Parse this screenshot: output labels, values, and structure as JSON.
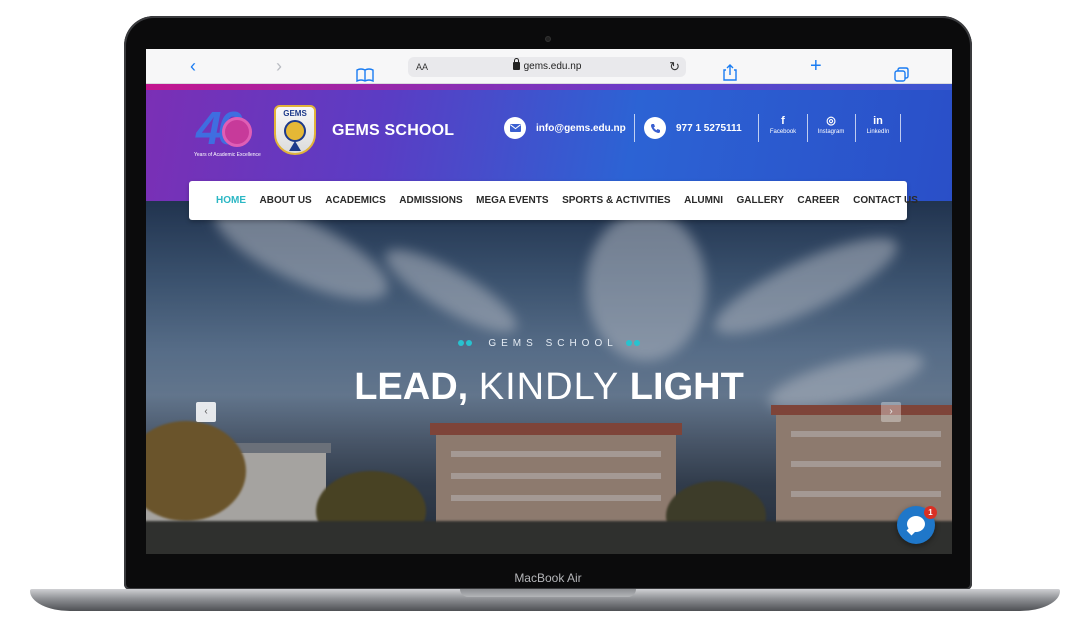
{
  "device": {
    "label": "MacBook Air"
  },
  "browser": {
    "text_size_label": "AA",
    "url": "gems.edu.np",
    "back_glyph": "‹",
    "forward_glyph": "›",
    "bookmarks_icon": "book-icon",
    "share_icon": "share-icon",
    "new_tab_glyph": "+",
    "tabs_icon": "tabs-icon",
    "reload_glyph": "↻"
  },
  "header": {
    "logo_40": {
      "number": "40",
      "tagline": "Years of Academic Excellence"
    },
    "shield_word": "GEMS",
    "site_title": "GEMS SCHOOL",
    "email": "info@gems.edu.np",
    "phone": "977 1 5275111",
    "social": [
      {
        "glyph": "f",
        "label": "Facebook",
        "icon": "facebook-icon"
      },
      {
        "glyph": "◎",
        "label": "Instagram",
        "icon": "instagram-icon"
      },
      {
        "glyph": "in",
        "label": "LinkedIn",
        "icon": "linkedin-icon"
      }
    ],
    "colors": {
      "gradient_start": "#7b2fb5",
      "gradient_end": "#2a4fc8",
      "accent": "#2bb7c4"
    }
  },
  "nav": {
    "items": [
      "HOME",
      "ABOUT US",
      "ACADEMICS",
      "ADMISSIONS",
      "MEGA EVENTS",
      "SPORTS & ACTIVITIES",
      "ALUMNI",
      "GALLERY",
      "CAREER",
      "CONTACT US"
    ],
    "active": "HOME"
  },
  "hero": {
    "eyebrow": "GEMS SCHOOL",
    "headline_part1": "LEAD,",
    "headline_part2": "KINDLY",
    "headline_part3": "LIGHT",
    "prev_glyph": "‹",
    "next_glyph": "›"
  },
  "chat": {
    "badge_count": "1"
  }
}
